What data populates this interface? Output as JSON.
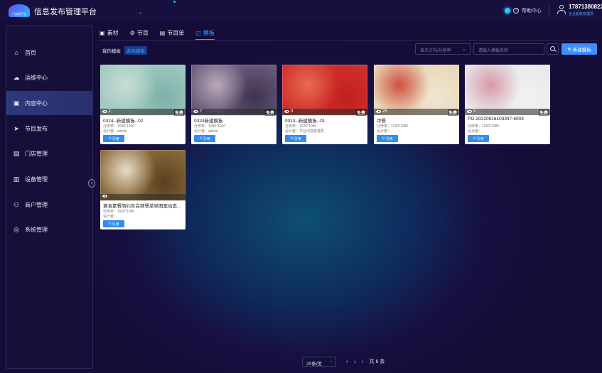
{
  "app": {
    "logo_text": "门店助手云",
    "title": "信息发布管理平台",
    "help_label": "帮助中心",
    "user_phone": "17871380822",
    "user_role": "企业超级管理员"
  },
  "sidebar": {
    "items": [
      {
        "label": "首页",
        "icon": "home-icon"
      },
      {
        "label": "运维中心",
        "icon": "cloud-ops-icon"
      },
      {
        "label": "内容中心",
        "icon": "content-icon",
        "active": true
      },
      {
        "label": "节目发布",
        "icon": "send-icon"
      },
      {
        "label": "门店管理",
        "icon": "store-icon"
      },
      {
        "label": "设备管理",
        "icon": "device-icon"
      },
      {
        "label": "商户管理",
        "icon": "merchant-icon"
      },
      {
        "label": "系统管理",
        "icon": "settings-icon"
      }
    ],
    "collapse_glyph": "‹"
  },
  "tabs": [
    {
      "label": "素材",
      "icon": "image-icon"
    },
    {
      "label": "节目",
      "icon": "program-icon"
    },
    {
      "label": "节目单",
      "icon": "playlist-icon"
    },
    {
      "label": "模板",
      "icon": "template-icon",
      "active": true
    }
  ],
  "subtabs": {
    "mine": "我的模板",
    "system": "系统模板"
  },
  "filters": {
    "direction_placeholder": "显示方向/分辨率",
    "search_placeholder": "请输入模板名称",
    "new_button": "新建模板"
  },
  "cards": [
    {
      "name": "0324--新建模板--02",
      "views": "1",
      "resolution_label": "分辨率：",
      "resolution": "1080*1920",
      "designer_label": "设计者：",
      "designer": "admin",
      "badge": "免费",
      "use_label": "引用",
      "thumb": [
        "#9ec9c0",
        "#c8ddd5",
        "#7fb0a8"
      ]
    },
    {
      "name": "0324新建模板",
      "views": "7",
      "resolution_label": "分辨率：",
      "resolution": "1080*1920",
      "designer_label": "设计者：",
      "designer": "admin",
      "badge": "免费",
      "use_label": "引用",
      "thumb": [
        "#6a5c7a",
        "#b8a9b8",
        "#3e3350"
      ]
    },
    {
      "name": "0313--新建模板--01",
      "views": "3",
      "resolution_label": "分辨率：",
      "resolution": "1920*1080",
      "designer_label": "设计者：",
      "designer": "平台内容管理员",
      "badge": "免费",
      "use_label": "引用",
      "thumb": [
        "#d0302a",
        "#e86a50",
        "#c22020"
      ]
    },
    {
      "name": "中餐",
      "views": "25",
      "resolution_label": "分辨率：",
      "resolution": "1920*1080",
      "designer_label": "设计者：",
      "designer": "",
      "badge": "免费",
      "use_label": "引用",
      "thumb": [
        "#e8d8b8",
        "#d05040",
        "#f0e6d0"
      ]
    },
    {
      "name": "PG-20220816103347-6003",
      "views": "2",
      "resolution_label": "分辨率：",
      "resolution": "1920*1080",
      "designer_label": "设计者：",
      "designer": "",
      "badge": "免费",
      "use_label": "引用",
      "thumb": [
        "#e8e8ea",
        "#d89aa8",
        "#f2f2f4"
      ]
    },
    {
      "name": "黄食素餐简约灰白频餐菜单图案动态...",
      "views": "",
      "resolution_label": "分辨率：",
      "resolution": "1920*1080",
      "designer_label": "设计者：",
      "designer": "",
      "badge": "",
      "use_label": "引用",
      "thumb": [
        "#8a6a3a",
        "#e8dcc8",
        "#5a4020"
      ]
    }
  ],
  "pager": {
    "page_size": "20条/页",
    "prev": "‹",
    "current": "1",
    "next": "›",
    "total": "共 6 条"
  },
  "colors": {
    "accent": "#3d8eff",
    "active_tab": "#3fa0ff"
  }
}
